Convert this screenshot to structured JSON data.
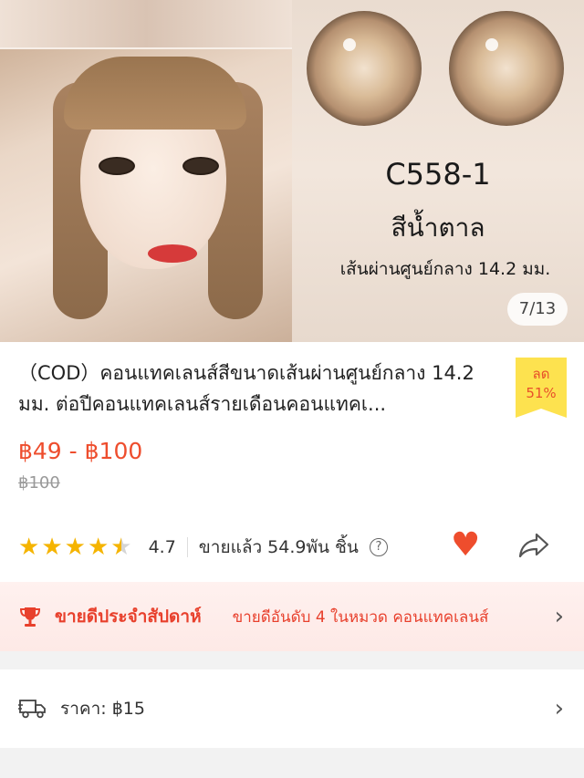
{
  "hero": {
    "product_code": "C558-1",
    "color_name": "สีน้ำตาล",
    "diameter_text": "เส้นผ่านศูนย์กลาง 14.2 มม.",
    "image_counter": "7/13"
  },
  "product": {
    "title": "（COD）คอนแทคเลนส์สีขนาดเส้นผ่านศูนย์กลาง 14.2 มม. ต่อปีคอนแทคเลนส์รายเดือนคอนแทคเ...",
    "discount_label": "ลด",
    "discount_value": "51%",
    "price_range": "฿49 - ฿100",
    "original_price": "฿100",
    "rating": "4.7",
    "rating_value": 4.7,
    "sold_text": "ขายแล้ว 54.9พัน ชิ้น"
  },
  "icons": {
    "help": "help-circle-icon",
    "favorite": "heart-icon",
    "share": "share-arrow-icon",
    "trophy": "trophy-icon",
    "truck": "delivery-truck-icon",
    "chevron": "chevron-right-icon"
  },
  "bestseller": {
    "label": "ขายดีประจำสัปดาห์",
    "detail": "ขายดีอันดับ 4 ในหมวด คอนแทคเลนส์"
  },
  "shipping": {
    "label": "ราคา: ฿15"
  },
  "colors": {
    "accent": "#ee4d2d",
    "star": "#f5b400",
    "discount_bg": "#fde24f"
  }
}
